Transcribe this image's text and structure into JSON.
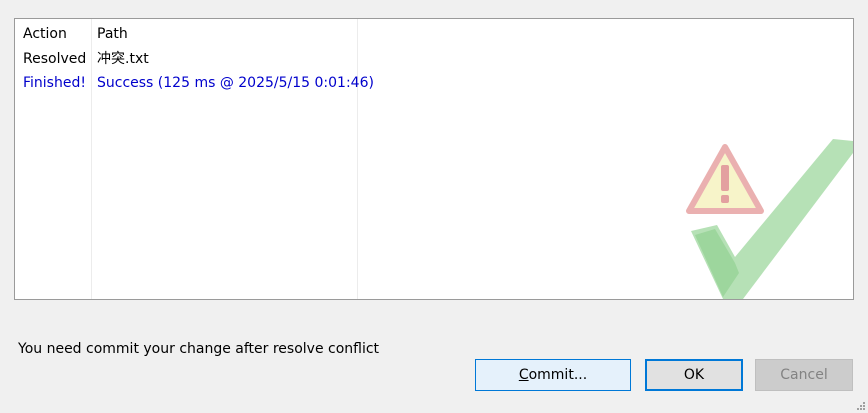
{
  "log": {
    "columns": [
      "Action",
      "Path"
    ],
    "rows": [
      {
        "action": "Resolved",
        "path": "冲突.txt",
        "color": "#000000"
      },
      {
        "action": "Finished!",
        "path": "Success (125 ms @ 2025/5/15 0:01:46)",
        "color": "#0000cc"
      }
    ]
  },
  "watermark": {
    "icon": "warning-check-icon",
    "warning_color": "#e8a0a0",
    "check_color": "#9ed89e"
  },
  "status_message": "You need commit your change after resolve conflict",
  "buttons": {
    "commit": {
      "mnemonic": "C",
      "rest": "ommit..."
    },
    "ok": "OK",
    "cancel": "Cancel"
  },
  "colors": {
    "accent": "#0078d7",
    "background": "#f0f0f0"
  }
}
